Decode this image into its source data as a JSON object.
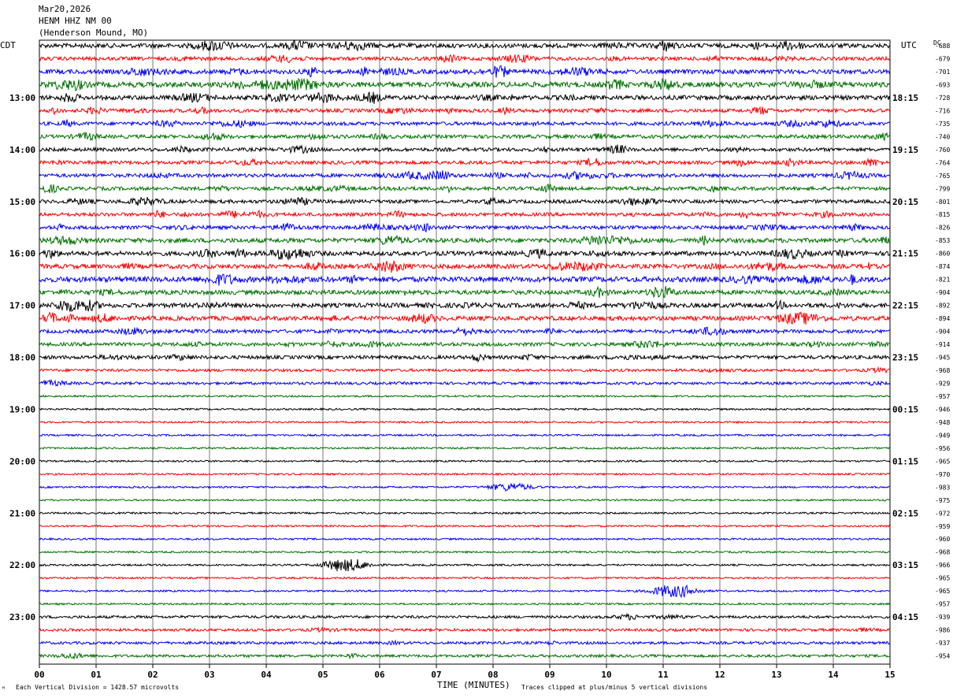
{
  "header": {
    "date": "Mar20,2026",
    "station": "HENM HHZ NM 00",
    "location": "(Henderson Mound, MO)"
  },
  "left_zone": "CDT",
  "right_zone": "UTC",
  "dc_label": "DC",
  "footer": {
    "scale_note": "Each Vertical Division = 1428.57 microvolts",
    "xlabel": "TIME (MINUTES)",
    "clip_note": "Traces clipped at plus/minus 5 vertical divisions",
    "corner_mark": "ᴹ"
  },
  "colors": {
    "trace_cycle": [
      "#000000",
      "#ff0000",
      "#0000ff",
      "#007000"
    ],
    "grid": "#777777",
    "text": "#000000"
  },
  "chart_data": {
    "type": "line",
    "title": "HENM HHZ NM 00",
    "xlabel": "TIME (MINUTES)",
    "xlim": [
      0,
      15
    ],
    "x_ticks": [
      "00",
      "01",
      "02",
      "03",
      "04",
      "05",
      "06",
      "07",
      "08",
      "09",
      "10",
      "11",
      "12",
      "13",
      "14",
      "15"
    ],
    "rows_per_hour": 4,
    "minutes_per_row": 15,
    "left_time_labels": [
      "13:00",
      "14:00",
      "15:00",
      "16:00",
      "17:00",
      "18:00",
      "19:00",
      "20:00",
      "21:00",
      "22:00",
      "23:00"
    ],
    "right_time_labels": [
      "18:15",
      "19:15",
      "20:15",
      "21:15",
      "22:15",
      "23:15",
      "00:15",
      "01:15",
      "02:15",
      "03:15",
      "04:15"
    ],
    "dc_offsets": [
      -688,
      -679,
      -701,
      -693,
      -728,
      -716,
      -735,
      -740,
      -760,
      -764,
      -765,
      -799,
      -801,
      -815,
      -826,
      -853,
      -860,
      -874,
      -821,
      -904,
      -892,
      -894,
      -904,
      -914,
      -945,
      -968,
      -929,
      -957,
      -946,
      -948,
      -949,
      -956,
      -965,
      -970,
      -983,
      -975,
      -972,
      -959,
      -960,
      -968,
      -966,
      -965,
      -965,
      -957,
      -939,
      -986,
      -937,
      -954
    ],
    "activity_level": [
      4,
      3,
      4,
      5,
      4,
      3,
      3,
      3,
      3,
      3,
      3,
      3,
      3,
      3,
      3,
      4,
      4,
      4,
      5,
      4,
      4,
      4,
      3,
      3,
      3,
      2,
      2,
      1,
      1,
      1,
      1,
      1,
      1,
      1,
      1,
      1,
      1,
      1,
      1,
      1,
      1,
      1,
      1,
      1,
      2,
      2,
      2,
      2
    ],
    "events": [
      {
        "row": 40,
        "minute": 5.4,
        "amplitude": 4
      },
      {
        "row": 42,
        "minute": 11.2,
        "amplitude": 4
      },
      {
        "row": 34,
        "minute": 8.3,
        "amplitude": 2
      }
    ]
  }
}
